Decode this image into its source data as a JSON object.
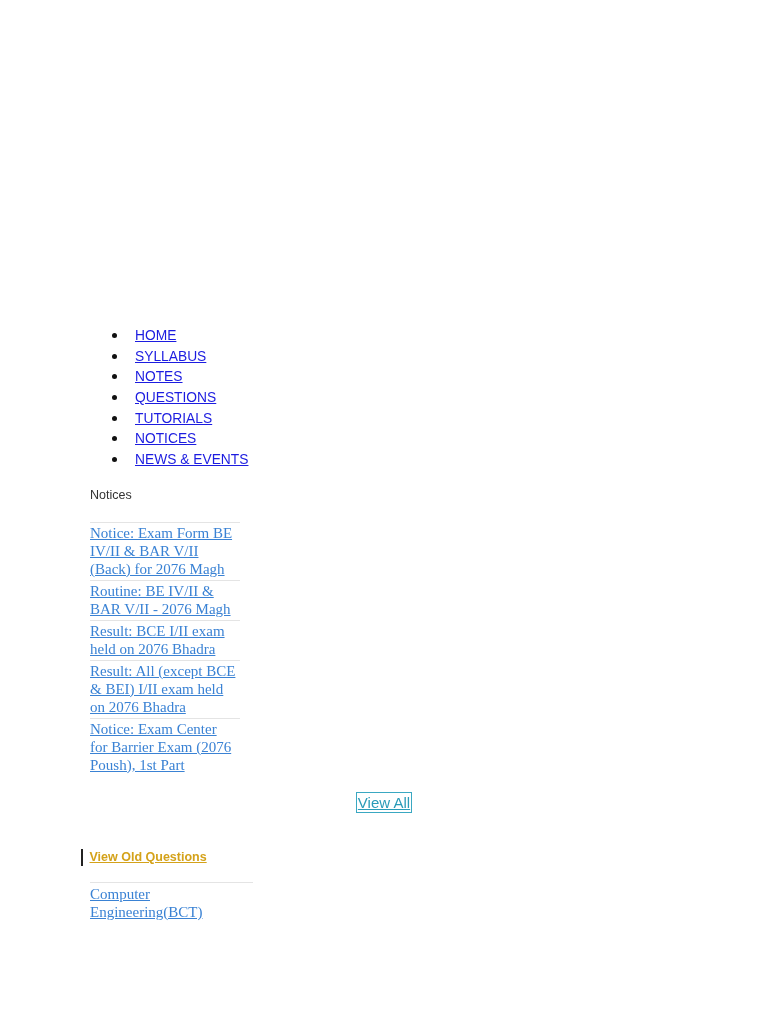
{
  "nav": {
    "items": [
      {
        "label": "HOME"
      },
      {
        "label": "SYLLABUS"
      },
      {
        "label": "NOTES"
      },
      {
        "label": "QUESTIONS"
      },
      {
        "label": "TUTORIALS"
      },
      {
        "label": "NOTICES"
      },
      {
        "label": "NEWS & EVENTS"
      }
    ]
  },
  "notices": {
    "heading": "Notices",
    "items": [
      "Notice: Exam Form BE IV/II & BAR V/II (Back) for 2076 Magh",
      "Routine: BE IV/II & BAR V/II - 2076 Magh",
      "Result: BCE I/II exam held on 2076 Bhadra",
      "Result: All (except BCE & BEI) I/II exam held on 2076 Bhadra",
      "Notice: Exam Center for Barrier Exam (2076 Poush), 1st Part"
    ],
    "view_all": "View All"
  },
  "old_questions": {
    "heading": "View Old Questions",
    "items": [
      "Computer Engineering(BCT)"
    ]
  }
}
